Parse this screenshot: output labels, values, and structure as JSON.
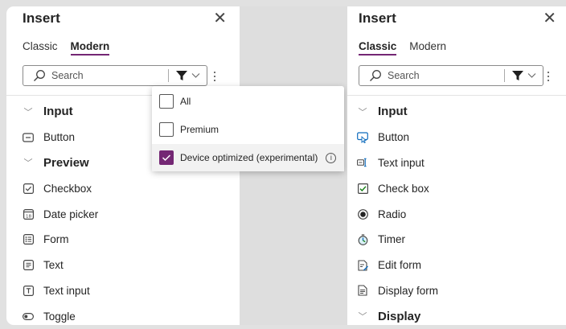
{
  "left": {
    "title": "Insert",
    "tabs": [
      {
        "label": "Classic"
      },
      {
        "label": "Modern"
      }
    ],
    "selected_tab": "Modern",
    "search_placeholder": "Search",
    "categories": [
      {
        "label": "Input",
        "items": [
          {
            "label": "Button",
            "icon": "button-icon"
          }
        ]
      },
      {
        "label": "Preview",
        "items": [
          {
            "label": "Checkbox",
            "icon": "checkbox-icon"
          },
          {
            "label": "Date picker",
            "icon": "date-picker-icon"
          },
          {
            "label": "Form",
            "icon": "form-icon"
          },
          {
            "label": "Text",
            "icon": "text-icon"
          },
          {
            "label": "Text input",
            "icon": "text-input-icon"
          },
          {
            "label": "Toggle",
            "icon": "toggle-icon"
          }
        ]
      }
    ],
    "filter_menu": [
      {
        "label": "All",
        "checked": false
      },
      {
        "label": "Premium",
        "checked": false
      },
      {
        "label": "Device optimized (experimental)",
        "checked": true
      }
    ]
  },
  "right": {
    "title": "Insert",
    "tabs": [
      {
        "label": "Classic"
      },
      {
        "label": "Modern"
      }
    ],
    "selected_tab": "Classic",
    "search_placeholder": "Search",
    "categories": [
      {
        "label": "Input",
        "items": [
          {
            "label": "Button",
            "icon": "button-icon"
          },
          {
            "label": "Text input",
            "icon": "text-input-icon"
          },
          {
            "label": "Check box",
            "icon": "checkbox-icon"
          },
          {
            "label": "Radio",
            "icon": "radio-icon"
          },
          {
            "label": "Timer",
            "icon": "timer-icon"
          },
          {
            "label": "Edit form",
            "icon": "edit-form-icon"
          },
          {
            "label": "Display form",
            "icon": "display-form-icon"
          }
        ]
      },
      {
        "label": "Display",
        "items": []
      }
    ]
  },
  "colors": {
    "accent": "#742774",
    "background": "#e1e1e1",
    "panel": "#ffffff"
  }
}
